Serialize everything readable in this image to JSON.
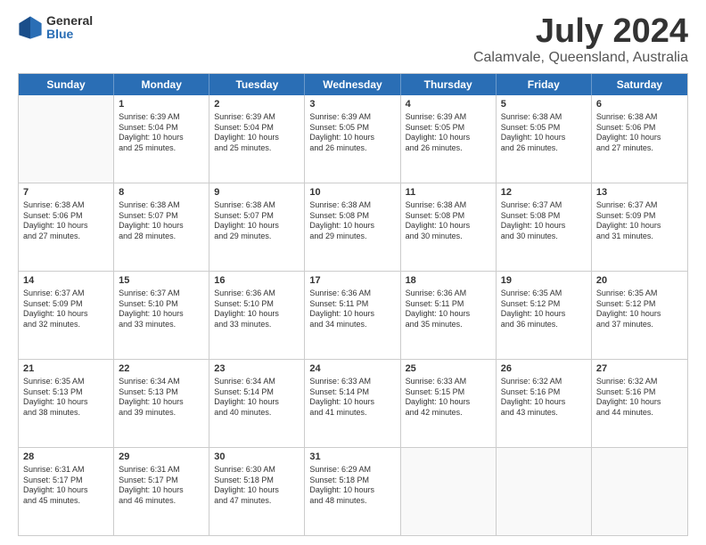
{
  "header": {
    "logo": {
      "general": "General",
      "blue": "Blue"
    },
    "month": "July 2024",
    "location": "Calamvale, Queensland, Australia"
  },
  "weekdays": [
    "Sunday",
    "Monday",
    "Tuesday",
    "Wednesday",
    "Thursday",
    "Friday",
    "Saturday"
  ],
  "weeks": [
    [
      {
        "day": "",
        "empty": true
      },
      {
        "day": "1",
        "sunrise": "6:39 AM",
        "sunset": "5:04 PM",
        "daylight": "10 hours and 25 minutes."
      },
      {
        "day": "2",
        "sunrise": "6:39 AM",
        "sunset": "5:04 PM",
        "daylight": "10 hours and 25 minutes."
      },
      {
        "day": "3",
        "sunrise": "6:39 AM",
        "sunset": "5:05 PM",
        "daylight": "10 hours and 26 minutes."
      },
      {
        "day": "4",
        "sunrise": "6:39 AM",
        "sunset": "5:05 PM",
        "daylight": "10 hours and 26 minutes."
      },
      {
        "day": "5",
        "sunrise": "6:38 AM",
        "sunset": "5:05 PM",
        "daylight": "10 hours and 26 minutes."
      },
      {
        "day": "6",
        "sunrise": "6:38 AM",
        "sunset": "5:06 PM",
        "daylight": "10 hours and 27 minutes."
      }
    ],
    [
      {
        "day": "7",
        "sunrise": "6:38 AM",
        "sunset": "5:06 PM",
        "daylight": "10 hours and 27 minutes."
      },
      {
        "day": "8",
        "sunrise": "6:38 AM",
        "sunset": "5:07 PM",
        "daylight": "10 hours and 28 minutes."
      },
      {
        "day": "9",
        "sunrise": "6:38 AM",
        "sunset": "5:07 PM",
        "daylight": "10 hours and 29 minutes."
      },
      {
        "day": "10",
        "sunrise": "6:38 AM",
        "sunset": "5:08 PM",
        "daylight": "10 hours and 29 minutes."
      },
      {
        "day": "11",
        "sunrise": "6:38 AM",
        "sunset": "5:08 PM",
        "daylight": "10 hours and 30 minutes."
      },
      {
        "day": "12",
        "sunrise": "6:37 AM",
        "sunset": "5:08 PM",
        "daylight": "10 hours and 30 minutes."
      },
      {
        "day": "13",
        "sunrise": "6:37 AM",
        "sunset": "5:09 PM",
        "daylight": "10 hours and 31 minutes."
      }
    ],
    [
      {
        "day": "14",
        "sunrise": "6:37 AM",
        "sunset": "5:09 PM",
        "daylight": "10 hours and 32 minutes."
      },
      {
        "day": "15",
        "sunrise": "6:37 AM",
        "sunset": "5:10 PM",
        "daylight": "10 hours and 33 minutes."
      },
      {
        "day": "16",
        "sunrise": "6:36 AM",
        "sunset": "5:10 PM",
        "daylight": "10 hours and 33 minutes."
      },
      {
        "day": "17",
        "sunrise": "6:36 AM",
        "sunset": "5:11 PM",
        "daylight": "10 hours and 34 minutes."
      },
      {
        "day": "18",
        "sunrise": "6:36 AM",
        "sunset": "5:11 PM",
        "daylight": "10 hours and 35 minutes."
      },
      {
        "day": "19",
        "sunrise": "6:35 AM",
        "sunset": "5:12 PM",
        "daylight": "10 hours and 36 minutes."
      },
      {
        "day": "20",
        "sunrise": "6:35 AM",
        "sunset": "5:12 PM",
        "daylight": "10 hours and 37 minutes."
      }
    ],
    [
      {
        "day": "21",
        "sunrise": "6:35 AM",
        "sunset": "5:13 PM",
        "daylight": "10 hours and 38 minutes."
      },
      {
        "day": "22",
        "sunrise": "6:34 AM",
        "sunset": "5:13 PM",
        "daylight": "10 hours and 39 minutes."
      },
      {
        "day": "23",
        "sunrise": "6:34 AM",
        "sunset": "5:14 PM",
        "daylight": "10 hours and 40 minutes."
      },
      {
        "day": "24",
        "sunrise": "6:33 AM",
        "sunset": "5:14 PM",
        "daylight": "10 hours and 41 minutes."
      },
      {
        "day": "25",
        "sunrise": "6:33 AM",
        "sunset": "5:15 PM",
        "daylight": "10 hours and 42 minutes."
      },
      {
        "day": "26",
        "sunrise": "6:32 AM",
        "sunset": "5:16 PM",
        "daylight": "10 hours and 43 minutes."
      },
      {
        "day": "27",
        "sunrise": "6:32 AM",
        "sunset": "5:16 PM",
        "daylight": "10 hours and 44 minutes."
      }
    ],
    [
      {
        "day": "28",
        "sunrise": "6:31 AM",
        "sunset": "5:17 PM",
        "daylight": "10 hours and 45 minutes."
      },
      {
        "day": "29",
        "sunrise": "6:31 AM",
        "sunset": "5:17 PM",
        "daylight": "10 hours and 46 minutes."
      },
      {
        "day": "30",
        "sunrise": "6:30 AM",
        "sunset": "5:18 PM",
        "daylight": "10 hours and 47 minutes."
      },
      {
        "day": "31",
        "sunrise": "6:29 AM",
        "sunset": "5:18 PM",
        "daylight": "10 hours and 48 minutes."
      },
      {
        "day": "",
        "empty": true
      },
      {
        "day": "",
        "empty": true
      },
      {
        "day": "",
        "empty": true
      }
    ]
  ]
}
